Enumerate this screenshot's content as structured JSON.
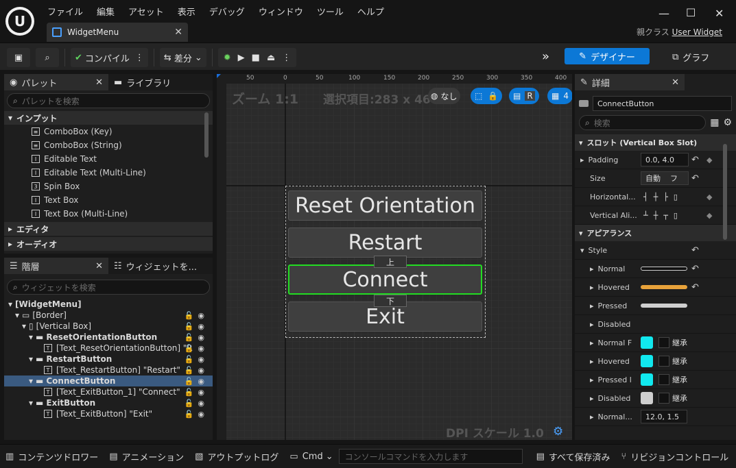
{
  "menu": [
    "ファイル",
    "編集",
    "アセット",
    "表示",
    "デバッグ",
    "ウィンドウ",
    "ツール",
    "ヘルプ"
  ],
  "doc_tab": "WidgetMenu",
  "parent_class_label": "親クラス",
  "parent_class": "User Widget",
  "toolbar": {
    "compile": "コンパイル",
    "diff": "差分",
    "designer": "デザイナー",
    "graph": "グラフ"
  },
  "palette": {
    "tab": "パレット",
    "tab2": "ライブラリ",
    "search_placeholder": "パレットを検索",
    "category_input": "インプット",
    "items": [
      "ComboBox (Key)",
      "ComboBox (String)",
      "Editable Text",
      "Editable Text (Multi-Line)",
      "Spin Box",
      "Text Box",
      "Text Box (Multi-Line)"
    ],
    "cat_editor": "エディタ",
    "cat_audio": "オーディオ"
  },
  "hierarchy": {
    "tab": "階層",
    "tab2": "ウィジェットを...",
    "search_placeholder": "ウィジェットを検索",
    "rows": [
      "[WidgetMenu]",
      "[Border]",
      "[Vertical Box]",
      "ResetOrientationButton",
      "[Text_ResetOrientationButton] \"R",
      "RestartButton",
      "[Text_RestartButton] \"Restart\"",
      "ConnectButton",
      "[Text_ExitButton_1] \"Connect\"",
      "ExitButton",
      "[Text_ExitButton] \"Exit\""
    ]
  },
  "canvas": {
    "zoom": "ズーム 1:1",
    "selection": "選択項目:283 x 46",
    "none": "なし",
    "r": "R",
    "four": "4",
    "dpi": "DPI スケール 1.0",
    "ruler_top": [
      "50",
      "0",
      "50",
      "100",
      "150",
      "200",
      "250",
      "300",
      "350",
      "400"
    ],
    "buttons": [
      "Reset Orientation",
      "Restart",
      "Connect",
      "Exit"
    ],
    "up": "上",
    "down": "下"
  },
  "details": {
    "tab": "詳細",
    "name": "ConnectButton",
    "search_placeholder": "検索",
    "slot": "スロット (Vertical Box Slot)",
    "padding_label": "Padding",
    "padding": "0.0, 4.0",
    "size_label": "Size",
    "size": "自動",
    "size_extra": "フ",
    "halign": "Horizontal...",
    "valign": "Vertical Ali...",
    "appearance": "アピアランス",
    "style": "Style",
    "normal": "Normal",
    "hovered": "Hovered",
    "pressed": "Pressed",
    "disabled": "Disabled",
    "normal_f": "Normal F",
    "hovered2": "Hovered",
    "pressed_l": "Pressed l",
    "disabled2": "Disabled",
    "inherit": "継承",
    "normal_pad": "Normal...",
    "normal_pad_val": "12.0, 1.5"
  },
  "statusbar": {
    "content_drawer": "コンテンツドロワー",
    "animation": "アニメーション",
    "output_log": "アウトプットログ",
    "cmd": "Cmd",
    "console_placeholder": "コンソールコマンドを入力します",
    "save_all": "すべて保存済み",
    "revision": "リビジョンコントロール"
  },
  "colors": {
    "accent": "#0c78d6",
    "selection_green": "#22dd22",
    "cyan": "#11e8ee",
    "orange": "#e8a23a"
  }
}
